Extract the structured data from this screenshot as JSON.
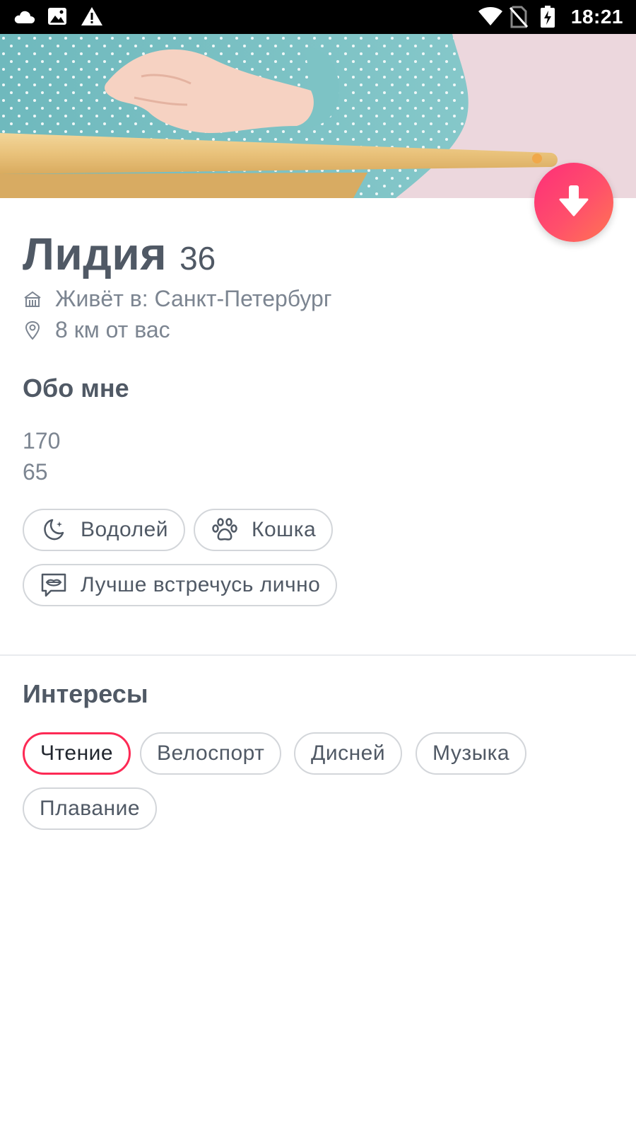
{
  "status_bar": {
    "time": "18:21",
    "left_icons": [
      "cloud-icon",
      "image-icon",
      "warning-icon"
    ],
    "right_icons": [
      "wifi-icon",
      "no-sim-icon",
      "battery-charging-icon"
    ]
  },
  "photo": {
    "description_icon": "profile-photo"
  },
  "action_button": {
    "icon": "arrow-down-icon",
    "gradient_from": "#fd2e79",
    "gradient_to": "#ff7652"
  },
  "profile": {
    "name": "Лидия",
    "age": "36",
    "lives_in": "Живёт в: Санкт-Петербург",
    "distance": "8 км от вас"
  },
  "about": {
    "title": "Обо мне",
    "lines": [
      "170",
      "65"
    ],
    "chips": [
      {
        "icon": "moon-stars-icon",
        "label": "Водолей"
      },
      {
        "icon": "paw-icon",
        "label": "Кошка"
      },
      {
        "icon": "chat-lips-icon",
        "label": "Лучше встречусь лично"
      }
    ]
  },
  "interests": {
    "title": "Интересы",
    "items": [
      {
        "label": "Чтение",
        "active": true
      },
      {
        "label": "Велоспорт",
        "active": false
      },
      {
        "label": "Дисней",
        "active": false
      },
      {
        "label": "Музыка",
        "active": false
      },
      {
        "label": "Плавание",
        "active": false
      }
    ]
  },
  "colors": {
    "accent": "#fd2a55",
    "text_primary": "#505965",
    "text_secondary": "#7c8591"
  }
}
